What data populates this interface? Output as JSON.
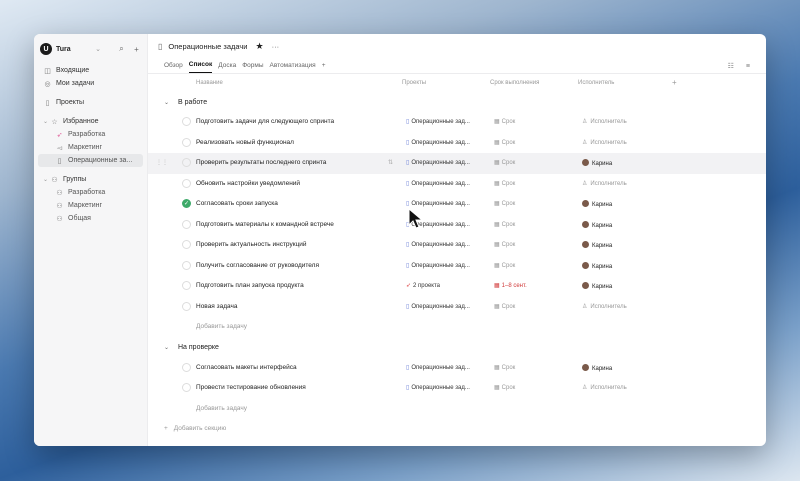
{
  "workspace": {
    "logo": "U",
    "name": "Tura"
  },
  "sidebar": {
    "top": [
      {
        "label": "Входящие",
        "icon": "inbox-icon"
      },
      {
        "label": "Мои задачи",
        "icon": "check-circle-icon"
      }
    ],
    "projects_label": "Проекты",
    "favorites_label": "Избранное",
    "favorites": [
      "Разработка",
      "Маркетинг",
      "Операционные за..."
    ],
    "groups_label": "Группы",
    "groups": [
      "Разработка",
      "Маркетинг",
      "Общая"
    ]
  },
  "header": {
    "title": "Операционные задачи"
  },
  "tabs": [
    "Обзор",
    "Список",
    "Доска",
    "Формы",
    "Автоматизация"
  ],
  "columns": {
    "name": "Название",
    "projects": "Проекты",
    "due": "Срок выполнения",
    "assignee": "Исполнитель"
  },
  "sections": [
    {
      "title": "В работе",
      "tasks": [
        {
          "name": "Подготовить задачи для следующего спринта",
          "project": "Операционные зад...",
          "due": "Срок",
          "assignee": "Исполнитель"
        },
        {
          "name": "Реализовать новый функционал",
          "project": "Операционные зад...",
          "due": "Срок",
          "assignee": "Исполнитель"
        },
        {
          "name": "Проверить результаты последнего спринта",
          "project": "Операционные зад...",
          "due": "Срок",
          "assignee": "Карина"
        },
        {
          "name": "Обновить настройки уведомлений",
          "project": "Операционные зад...",
          "due": "Срок",
          "assignee": "Исполнитель"
        },
        {
          "name": "Согласовать сроки запуска",
          "project": "Операционные зад...",
          "due": "Срок",
          "assignee": "Карина"
        },
        {
          "name": "Подготовить материалы к командной встрече",
          "project": "Операционные зад...",
          "due": "Срок",
          "assignee": "Карина"
        },
        {
          "name": "Проверить актуальность инструкций",
          "project": "Операционные зад...",
          "due": "Срок",
          "assignee": "Карина"
        },
        {
          "name": "Получить согласование от руководителя",
          "project": "Операционные зад...",
          "due": "Срок",
          "assignee": "Карина"
        },
        {
          "name": "Подготовить план запуска продукта",
          "project": "2 проекта",
          "due": "1–8 сент.",
          "assignee": "Карина"
        },
        {
          "name": "Новая задача",
          "project": "Операционные зад...",
          "due": "Срок",
          "assignee": "Исполнитель"
        }
      ],
      "add_task": "Добавить задачу"
    },
    {
      "title": "На проверке",
      "tasks": [
        {
          "name": "Согласовать макеты интерфейса",
          "project": "Операционные зад...",
          "due": "Срок",
          "assignee": "Карина"
        },
        {
          "name": "Провести тестирование обновления",
          "project": "Операционные зад...",
          "due": "Срок",
          "assignee": "Исполнитель"
        }
      ],
      "add_task": "Добавить задачу"
    }
  ],
  "add_section": "Добавить секцию"
}
